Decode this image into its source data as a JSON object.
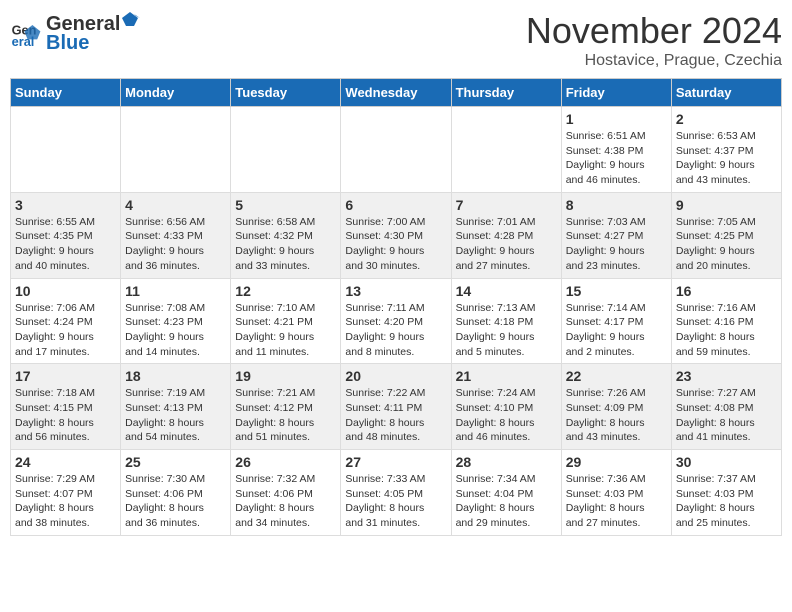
{
  "logo": {
    "line1": "General",
    "line2": "Blue"
  },
  "title": "November 2024",
  "location": "Hostavice, Prague, Czechia",
  "days_of_week": [
    "Sunday",
    "Monday",
    "Tuesday",
    "Wednesday",
    "Thursday",
    "Friday",
    "Saturday"
  ],
  "weeks": [
    [
      {
        "day": "",
        "info": ""
      },
      {
        "day": "",
        "info": ""
      },
      {
        "day": "",
        "info": ""
      },
      {
        "day": "",
        "info": ""
      },
      {
        "day": "",
        "info": ""
      },
      {
        "day": "1",
        "info": "Sunrise: 6:51 AM\nSunset: 4:38 PM\nDaylight: 9 hours\nand 46 minutes."
      },
      {
        "day": "2",
        "info": "Sunrise: 6:53 AM\nSunset: 4:37 PM\nDaylight: 9 hours\nand 43 minutes."
      }
    ],
    [
      {
        "day": "3",
        "info": "Sunrise: 6:55 AM\nSunset: 4:35 PM\nDaylight: 9 hours\nand 40 minutes."
      },
      {
        "day": "4",
        "info": "Sunrise: 6:56 AM\nSunset: 4:33 PM\nDaylight: 9 hours\nand 36 minutes."
      },
      {
        "day": "5",
        "info": "Sunrise: 6:58 AM\nSunset: 4:32 PM\nDaylight: 9 hours\nand 33 minutes."
      },
      {
        "day": "6",
        "info": "Sunrise: 7:00 AM\nSunset: 4:30 PM\nDaylight: 9 hours\nand 30 minutes."
      },
      {
        "day": "7",
        "info": "Sunrise: 7:01 AM\nSunset: 4:28 PM\nDaylight: 9 hours\nand 27 minutes."
      },
      {
        "day": "8",
        "info": "Sunrise: 7:03 AM\nSunset: 4:27 PM\nDaylight: 9 hours\nand 23 minutes."
      },
      {
        "day": "9",
        "info": "Sunrise: 7:05 AM\nSunset: 4:25 PM\nDaylight: 9 hours\nand 20 minutes."
      }
    ],
    [
      {
        "day": "10",
        "info": "Sunrise: 7:06 AM\nSunset: 4:24 PM\nDaylight: 9 hours\nand 17 minutes."
      },
      {
        "day": "11",
        "info": "Sunrise: 7:08 AM\nSunset: 4:23 PM\nDaylight: 9 hours\nand 14 minutes."
      },
      {
        "day": "12",
        "info": "Sunrise: 7:10 AM\nSunset: 4:21 PM\nDaylight: 9 hours\nand 11 minutes."
      },
      {
        "day": "13",
        "info": "Sunrise: 7:11 AM\nSunset: 4:20 PM\nDaylight: 9 hours\nand 8 minutes."
      },
      {
        "day": "14",
        "info": "Sunrise: 7:13 AM\nSunset: 4:18 PM\nDaylight: 9 hours\nand 5 minutes."
      },
      {
        "day": "15",
        "info": "Sunrise: 7:14 AM\nSunset: 4:17 PM\nDaylight: 9 hours\nand 2 minutes."
      },
      {
        "day": "16",
        "info": "Sunrise: 7:16 AM\nSunset: 4:16 PM\nDaylight: 8 hours\nand 59 minutes."
      }
    ],
    [
      {
        "day": "17",
        "info": "Sunrise: 7:18 AM\nSunset: 4:15 PM\nDaylight: 8 hours\nand 56 minutes."
      },
      {
        "day": "18",
        "info": "Sunrise: 7:19 AM\nSunset: 4:13 PM\nDaylight: 8 hours\nand 54 minutes."
      },
      {
        "day": "19",
        "info": "Sunrise: 7:21 AM\nSunset: 4:12 PM\nDaylight: 8 hours\nand 51 minutes."
      },
      {
        "day": "20",
        "info": "Sunrise: 7:22 AM\nSunset: 4:11 PM\nDaylight: 8 hours\nand 48 minutes."
      },
      {
        "day": "21",
        "info": "Sunrise: 7:24 AM\nSunset: 4:10 PM\nDaylight: 8 hours\nand 46 minutes."
      },
      {
        "day": "22",
        "info": "Sunrise: 7:26 AM\nSunset: 4:09 PM\nDaylight: 8 hours\nand 43 minutes."
      },
      {
        "day": "23",
        "info": "Sunrise: 7:27 AM\nSunset: 4:08 PM\nDaylight: 8 hours\nand 41 minutes."
      }
    ],
    [
      {
        "day": "24",
        "info": "Sunrise: 7:29 AM\nSunset: 4:07 PM\nDaylight: 8 hours\nand 38 minutes."
      },
      {
        "day": "25",
        "info": "Sunrise: 7:30 AM\nSunset: 4:06 PM\nDaylight: 8 hours\nand 36 minutes."
      },
      {
        "day": "26",
        "info": "Sunrise: 7:32 AM\nSunset: 4:06 PM\nDaylight: 8 hours\nand 34 minutes."
      },
      {
        "day": "27",
        "info": "Sunrise: 7:33 AM\nSunset: 4:05 PM\nDaylight: 8 hours\nand 31 minutes."
      },
      {
        "day": "28",
        "info": "Sunrise: 7:34 AM\nSunset: 4:04 PM\nDaylight: 8 hours\nand 29 minutes."
      },
      {
        "day": "29",
        "info": "Sunrise: 7:36 AM\nSunset: 4:03 PM\nDaylight: 8 hours\nand 27 minutes."
      },
      {
        "day": "30",
        "info": "Sunrise: 7:37 AM\nSunset: 4:03 PM\nDaylight: 8 hours\nand 25 minutes."
      }
    ]
  ]
}
